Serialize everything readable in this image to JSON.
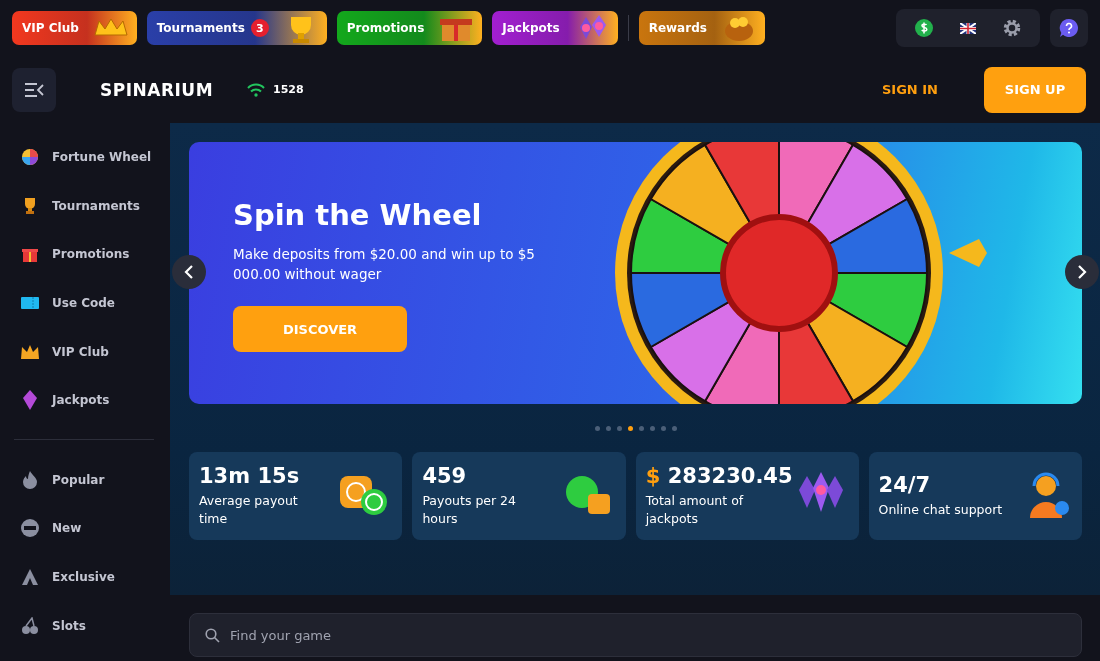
{
  "promo_bar": [
    {
      "label": "VIP Club",
      "color": "#f2381f"
    },
    {
      "label": "Tournaments",
      "color": "#2a3fa8",
      "badge": "3"
    },
    {
      "label": "Promotions",
      "color": "#13a81c"
    },
    {
      "label": "Jackpots",
      "color": "#a21fd0"
    },
    {
      "label": "Rewards",
      "color": "#c9750e"
    }
  ],
  "header": {
    "logo": "SPINARIUM",
    "online_count": "1528",
    "sign_in": "SIGN IN",
    "sign_up": "SIGN UP"
  },
  "sidebar": {
    "items": [
      {
        "label": "Fortune Wheel"
      },
      {
        "label": "Tournaments"
      },
      {
        "label": "Promotions"
      },
      {
        "label": "Use Code"
      },
      {
        "label": "VIP Club"
      },
      {
        "label": "Jackpots"
      }
    ],
    "categories": [
      {
        "label": "Popular"
      },
      {
        "label": "New"
      },
      {
        "label": "Exclusive"
      },
      {
        "label": "Slots"
      }
    ]
  },
  "banner": {
    "title": "Spin the Wheel",
    "text": "Make deposits from $20.00 and win up to $5 000.00 without wager",
    "button": "DISCOVER"
  },
  "carousel_dots": [
    {
      "selected": false
    },
    {
      "selected": false
    },
    {
      "selected": false
    },
    {
      "selected": true
    },
    {
      "selected": false
    },
    {
      "selected": false
    },
    {
      "selected": false
    },
    {
      "selected": false
    }
  ],
  "stats": [
    {
      "value": "13m 15s",
      "label": "Average payout time"
    },
    {
      "value": "459",
      "label": "Payouts per 24 hours"
    },
    {
      "prefix": "$",
      "value": "283230.45",
      "label": "Total amount of jackpots"
    },
    {
      "value": "24/7",
      "label": "Online chat support"
    }
  ],
  "search": {
    "placeholder": "Find your game"
  }
}
